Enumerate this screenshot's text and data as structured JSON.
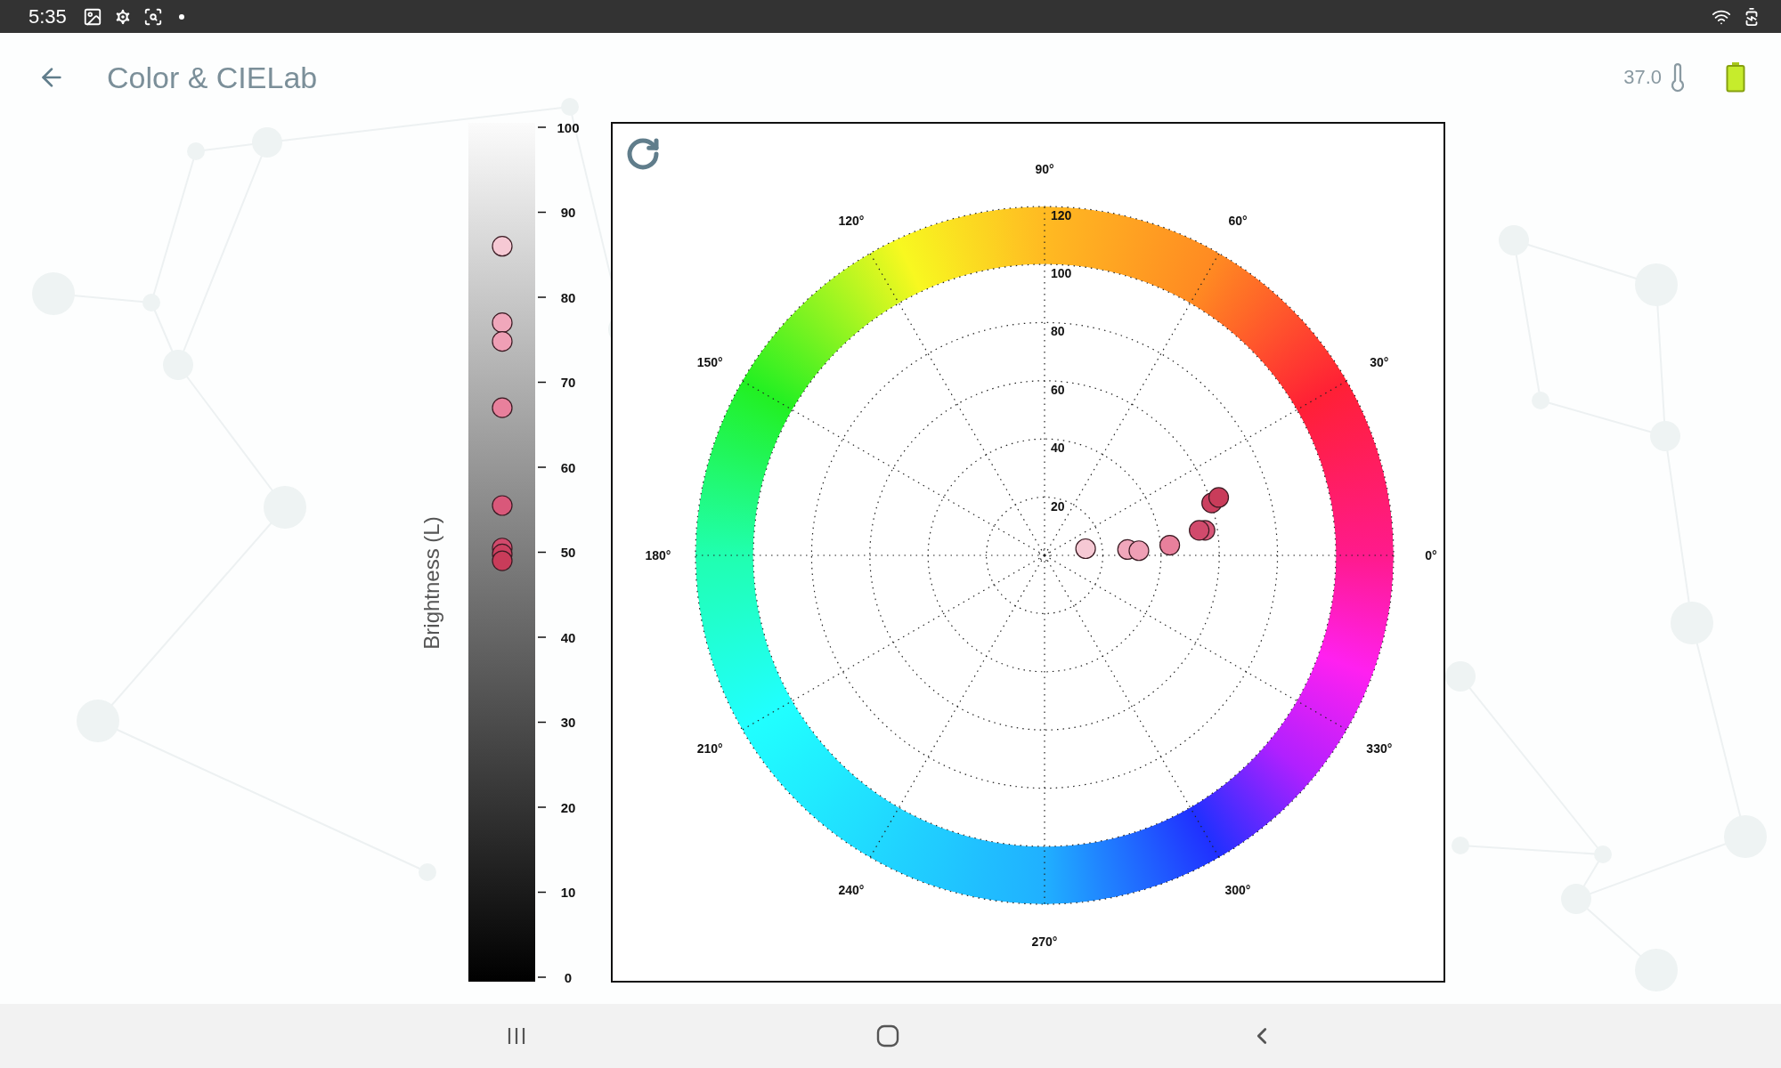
{
  "status_bar": {
    "time": "5:35"
  },
  "header": {
    "title": "Color & CIELab",
    "temperature": "37.0"
  },
  "brightness_chart": {
    "axis_title": "Brightness (L)",
    "ticks": [
      "100",
      "90",
      "80",
      "70",
      "60",
      "50",
      "40",
      "30",
      "20",
      "10",
      "0"
    ],
    "points": [
      {
        "color": "#f6c9d4"
      },
      {
        "color": "#f0a7bb"
      },
      {
        "color": "#ef9fb5"
      },
      {
        "color": "#e8809c"
      },
      {
        "color": "#d9587a"
      },
      {
        "color": "#d14a6c"
      },
      {
        "color": "#cc4060"
      },
      {
        "color": "#c93c5a"
      }
    ]
  },
  "cielab_chart": {
    "angle_labels": [
      "0°",
      "30°",
      "60°",
      "90°",
      "120°",
      "150°",
      "180°",
      "210°",
      "240°",
      "270°",
      "300°",
      "330°"
    ],
    "radial_ticks": [
      "120",
      "100",
      "80",
      "60",
      "40",
      "20"
    ],
    "points": [
      {
        "color": "#f6c9d4"
      },
      {
        "color": "#f0a7bb"
      },
      {
        "color": "#ef9fb5"
      },
      {
        "color": "#e8809c"
      },
      {
        "color": "#d9587a"
      },
      {
        "color": "#d14a6c"
      },
      {
        "color": "#cc4060"
      },
      {
        "color": "#c93c5a"
      }
    ]
  }
}
